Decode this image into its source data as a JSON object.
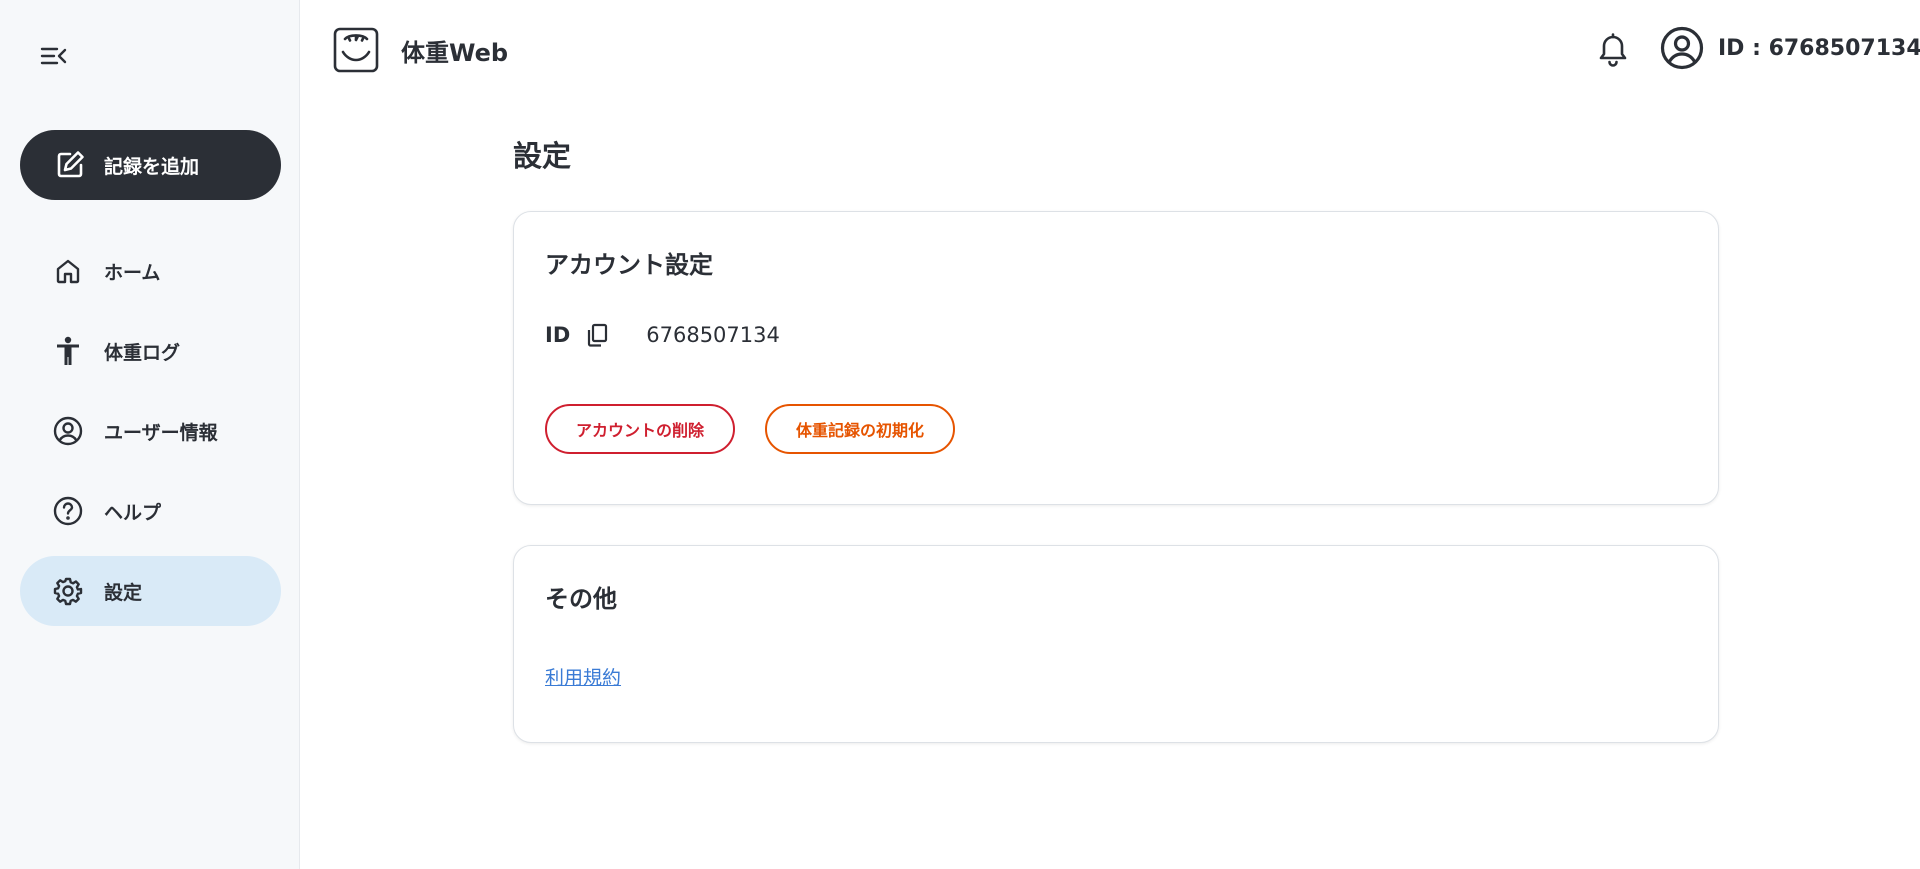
{
  "app": {
    "title": "体重Web"
  },
  "header": {
    "user_id": "ID : 6768507134"
  },
  "sidebar": {
    "add_record_label": "記録を追加",
    "items": [
      {
        "label": "ホーム",
        "icon": "home-icon"
      },
      {
        "label": "体重ログ",
        "icon": "person-icon"
      },
      {
        "label": "ユーザー情報",
        "icon": "account-circle-icon"
      },
      {
        "label": "ヘルプ",
        "icon": "help-icon"
      },
      {
        "label": "設定",
        "icon": "gear-icon",
        "active": true
      }
    ]
  },
  "main": {
    "page_title": "設定",
    "account_card": {
      "title": "アカウント設定",
      "id_label": "ID",
      "id_value": "6768507134",
      "delete_account_label": "アカウントの削除",
      "reset_records_label": "体重記録の初期化"
    },
    "other_card": {
      "title": "その他",
      "terms_link": "利用規約"
    }
  },
  "colors": {
    "sidebar_bg": "#f6f8fa",
    "primary_dark": "#2b2f36",
    "active_nav_bg": "#d9eaf7",
    "danger": "#cf1f2f",
    "warning": "#e65400",
    "link": "#3a7bd5"
  }
}
